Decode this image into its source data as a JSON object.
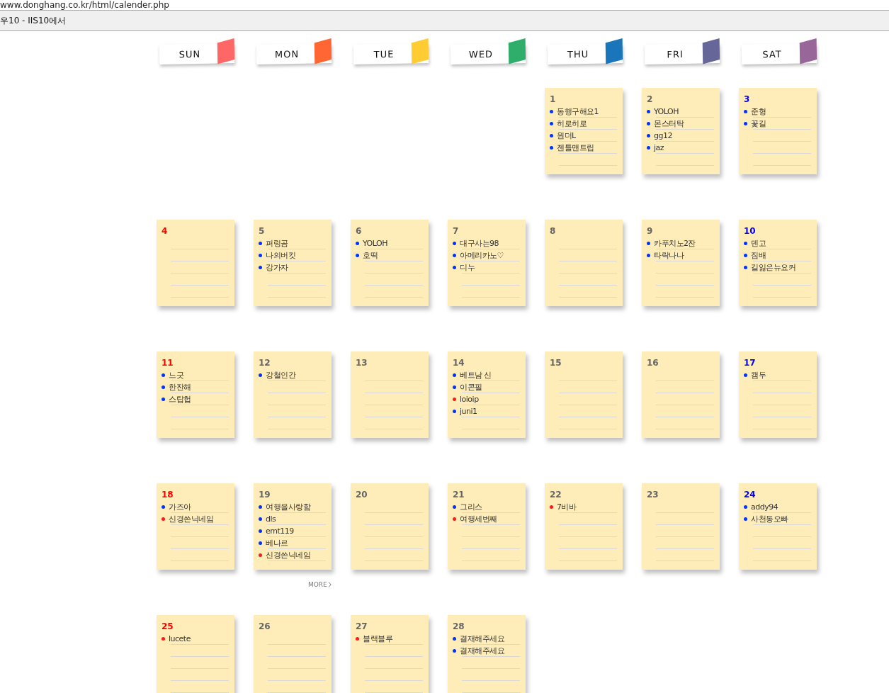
{
  "browser": {
    "address": "www.donghang.co.kr/html/calender.php",
    "tab_title": "우10 - IIS10에서"
  },
  "weekdays": [
    {
      "label": "SUN",
      "color": "#ff6666"
    },
    {
      "label": "MON",
      "color": "#ff6633"
    },
    {
      "label": "TUE",
      "color": "#ffcc33"
    },
    {
      "label": "WED",
      "color": "#2eae6a"
    },
    {
      "label": "THU",
      "color": "#1a75bb"
    },
    {
      "label": "FRI",
      "color": "#666699"
    },
    {
      "label": "SAT",
      "color": "#996699"
    }
  ],
  "weeks": [
    [
      {
        "kind": "blank"
      },
      {
        "kind": "blank"
      },
      {
        "kind": "blank"
      },
      {
        "kind": "blank"
      },
      {
        "kind": "weekday",
        "day": "1",
        "entries": [
          {
            "text": "동행구해요1",
            "color": "#0033ff"
          },
          {
            "text": "히로히로",
            "color": "#0033ff"
          },
          {
            "text": "원더L",
            "color": "#0033ff"
          },
          {
            "text": "젠틀맨트립",
            "color": "#0033ff"
          }
        ]
      },
      {
        "kind": "weekday",
        "day": "2",
        "entries": [
          {
            "text": "YOLOH",
            "color": "#0033ff"
          },
          {
            "text": "몬스터탁",
            "color": "#0033ff"
          },
          {
            "text": "gg12",
            "color": "#0033ff"
          },
          {
            "text": "jaz",
            "color": "#0033ff"
          }
        ]
      },
      {
        "kind": "saturday",
        "day": "3",
        "entries": [
          {
            "text": "준형",
            "color": "#0033ff"
          },
          {
            "text": "꽃길",
            "color": "#0033ff"
          }
        ]
      }
    ],
    [
      {
        "kind": "sunday",
        "day": "4"
      },
      {
        "kind": "weekday",
        "day": "5",
        "entries": [
          {
            "text": "퍼렁곰",
            "color": "#0033ff"
          },
          {
            "text": "나의버킷",
            "color": "#0033ff"
          },
          {
            "text": "강가자",
            "color": "#0033ff"
          }
        ]
      },
      {
        "kind": "weekday",
        "day": "6",
        "entries": [
          {
            "text": "YOLOH",
            "color": "#0033ff"
          },
          {
            "text": "호떡",
            "color": "#0033ff"
          }
        ]
      },
      {
        "kind": "weekday",
        "day": "7",
        "entries": [
          {
            "text": "대구사는98",
            "color": "#0033ff"
          },
          {
            "text": "아메리카노♡",
            "color": "#0033ff"
          },
          {
            "text": "디누",
            "color": "#0033ff"
          }
        ]
      },
      {
        "kind": "weekday",
        "day": "8"
      },
      {
        "kind": "weekday",
        "day": "9",
        "entries": [
          {
            "text": "카푸치노2잔",
            "color": "#0033ff"
          },
          {
            "text": "타락나나",
            "color": "#0033ff"
          }
        ]
      },
      {
        "kind": "saturday",
        "day": "10",
        "entries": [
          {
            "text": "덴고",
            "color": "#0033ff"
          },
          {
            "text": "짐배",
            "color": "#0033ff"
          },
          {
            "text": "길잃은뉴요커",
            "color": "#0033ff"
          }
        ]
      }
    ],
    [
      {
        "kind": "sunday",
        "day": "11",
        "entries": [
          {
            "text": "느긋",
            "color": "#0033ff"
          },
          {
            "text": "한잔해",
            "color": "#0033ff"
          },
          {
            "text": "스탑헙",
            "color": "#0033ff"
          }
        ]
      },
      {
        "kind": "weekday",
        "day": "12",
        "entries": [
          {
            "text": "강철인간",
            "color": "#0033ff"
          }
        ]
      },
      {
        "kind": "weekday",
        "day": "13"
      },
      {
        "kind": "weekday",
        "day": "14",
        "entries": [
          {
            "text": "베트남 신",
            "color": "#0033ff"
          },
          {
            "text": "이콘필",
            "color": "#0033ff"
          },
          {
            "text": "loioip",
            "color": "#ff1a1a"
          },
          {
            "text": "juni1",
            "color": "#0033ff"
          }
        ]
      },
      {
        "kind": "weekday",
        "day": "15"
      },
      {
        "kind": "weekday",
        "day": "16"
      },
      {
        "kind": "saturday",
        "day": "17",
        "entries": [
          {
            "text": "캠두",
            "color": "#0033ff"
          }
        ]
      }
    ],
    [
      {
        "kind": "sunday",
        "day": "18",
        "entries": [
          {
            "text": "가즈아",
            "color": "#0033ff"
          },
          {
            "text": "신경쓴닉네임",
            "color": "#ff1a1a"
          }
        ]
      },
      {
        "kind": "weekday",
        "day": "19",
        "entries": [
          {
            "text": "여행을사랑함",
            "color": "#0033ff"
          },
          {
            "text": "dls",
            "color": "#0033ff"
          },
          {
            "text": "emt119",
            "color": "#0033ff"
          },
          {
            "text": "베나르",
            "color": "#0033ff"
          },
          {
            "text": "신경쓴닉네임",
            "color": "#ff1a1a"
          }
        ],
        "more": "MORE"
      },
      {
        "kind": "weekday",
        "day": "20"
      },
      {
        "kind": "weekday",
        "day": "21",
        "entries": [
          {
            "text": "그리스",
            "color": "#0033ff"
          },
          {
            "text": "여행세번째",
            "color": "#ff1a1a"
          }
        ]
      },
      {
        "kind": "weekday",
        "day": "22",
        "entries": [
          {
            "text": "7비바",
            "color": "#ff1a1a"
          }
        ]
      },
      {
        "kind": "weekday",
        "day": "23"
      },
      {
        "kind": "saturday",
        "day": "24",
        "entries": [
          {
            "text": "addy94",
            "color": "#0033ff"
          },
          {
            "text": "사천동오빠",
            "color": "#0033ff"
          }
        ]
      }
    ],
    [
      {
        "kind": "sunday",
        "day": "25",
        "entries": [
          {
            "text": "lucete",
            "color": "#ff1a1a"
          }
        ]
      },
      {
        "kind": "weekday",
        "day": "26"
      },
      {
        "kind": "weekday",
        "day": "27",
        "entries": [
          {
            "text": "블랙블루",
            "color": "#ff1a1a"
          }
        ]
      },
      {
        "kind": "weekday",
        "day": "28",
        "entries": [
          {
            "text": "결재해주세요",
            "color": "#0033ff"
          },
          {
            "text": "결재해주세요",
            "color": "#0033ff"
          }
        ]
      }
    ]
  ]
}
